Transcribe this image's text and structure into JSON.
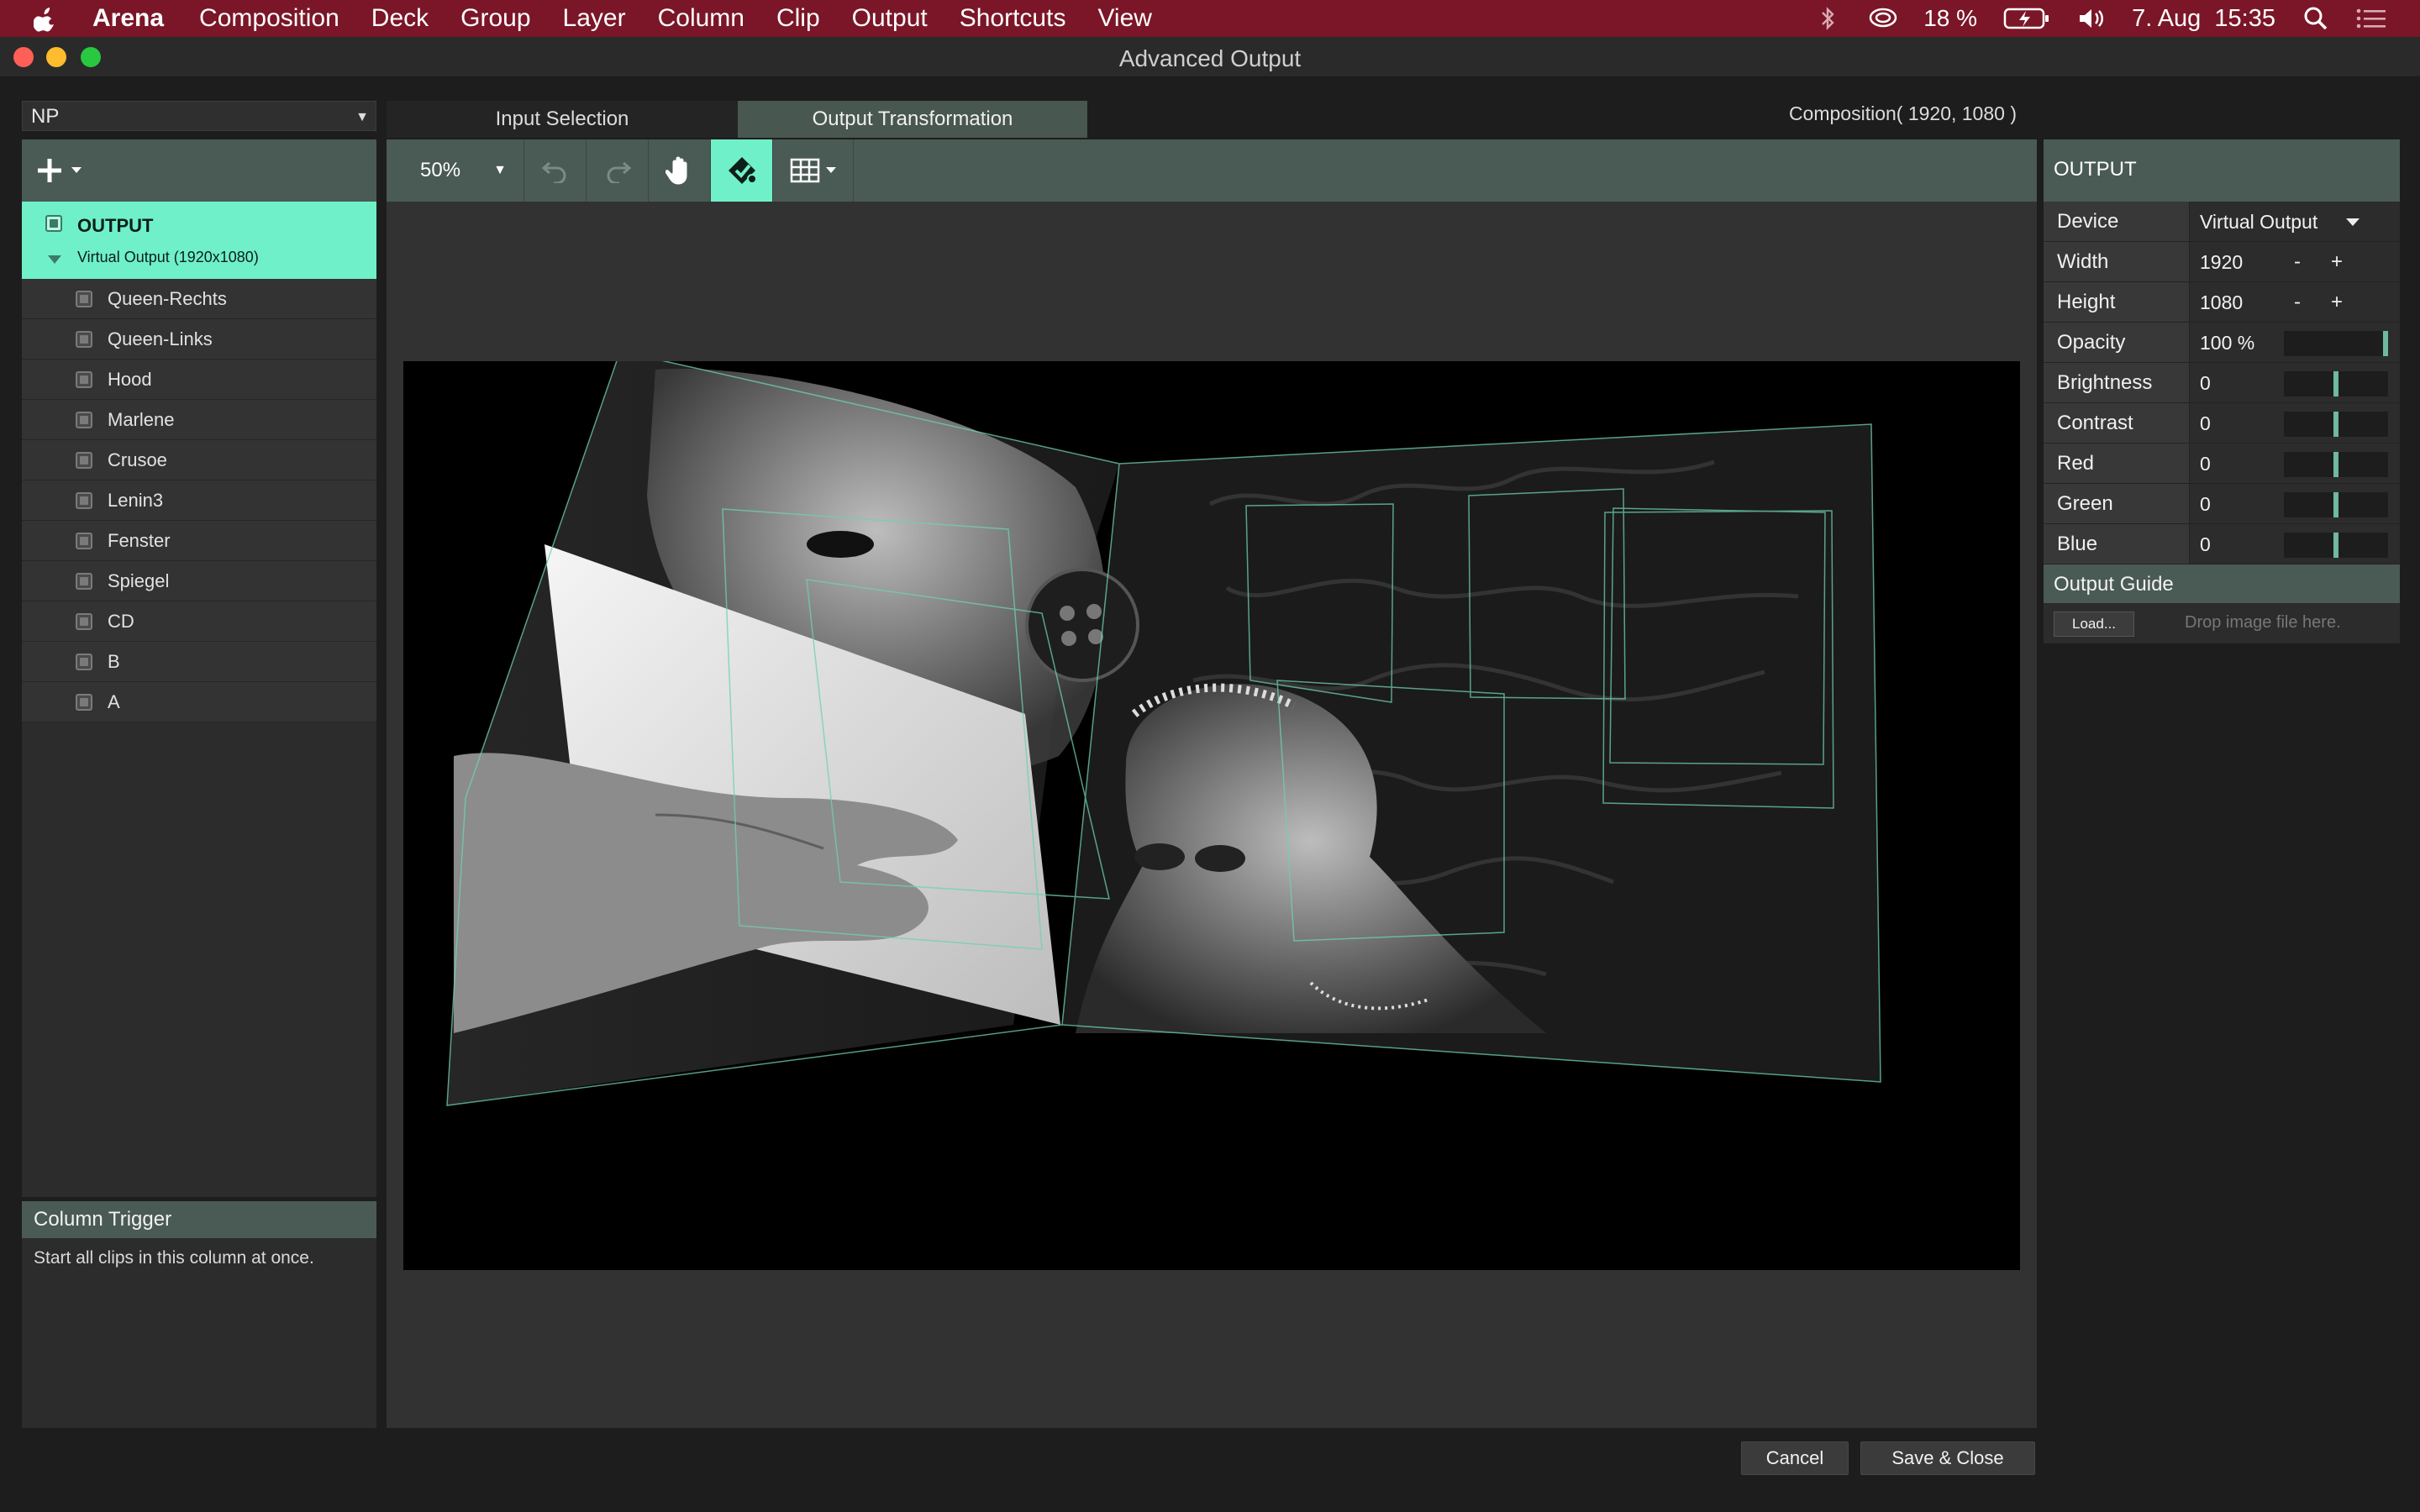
{
  "menubar": {
    "app": "Arena",
    "items": [
      "Composition",
      "Deck",
      "Group",
      "Layer",
      "Column",
      "Clip",
      "Output",
      "Shortcuts",
      "View"
    ],
    "battery": "18 %",
    "datetime": "7. Aug  15:35"
  },
  "window": {
    "title": "Advanced Output"
  },
  "left": {
    "preset": "NP",
    "output": {
      "title": "OUTPUT",
      "subtitle": "Virtual Output (1920x1080)"
    },
    "layers": [
      "Queen-Rechts",
      "Queen-Links",
      "Hood",
      "Marlene",
      "Crusoe",
      "Lenin3",
      "Fenster",
      "Spiegel",
      "CD",
      "B",
      "A"
    ],
    "help": {
      "title": "Column Trigger",
      "text": "Start all clips in this column at once."
    }
  },
  "center": {
    "tabs": [
      "Input Selection",
      "Output Transformation"
    ],
    "active_tab": "Output Transformation",
    "composition_info": "Composition( 1920, 1080 )",
    "zoom": "50%"
  },
  "properties": {
    "title": "OUTPUT",
    "device": {
      "label": "Device",
      "value": "Virtual Output"
    },
    "width": {
      "label": "Width",
      "value": "1920",
      "minus": "-",
      "plus": "+"
    },
    "height": {
      "label": "Height",
      "value": "1080",
      "minus": "-",
      "plus": "+"
    },
    "sliders": [
      {
        "label": "Opacity",
        "value": "100 %",
        "level": 1.0
      },
      {
        "label": "Brightness",
        "value": "0",
        "level": 0.5
      },
      {
        "label": "Contrast",
        "value": "0",
        "level": 0.5
      },
      {
        "label": "Red",
        "value": "0",
        "level": 0.5
      },
      {
        "label": "Green",
        "value": "0",
        "level": 0.5
      },
      {
        "label": "Blue",
        "value": "0",
        "level": 0.5
      }
    ],
    "guide": {
      "title": "Output Guide",
      "load": "Load...",
      "hint": "Drop image file here."
    }
  },
  "footer": {
    "cancel": "Cancel",
    "save": "Save & Close"
  },
  "colors": {
    "accent": "#6ff0c8",
    "panel_header": "#4a5a55",
    "menubar": "#7a1628"
  }
}
